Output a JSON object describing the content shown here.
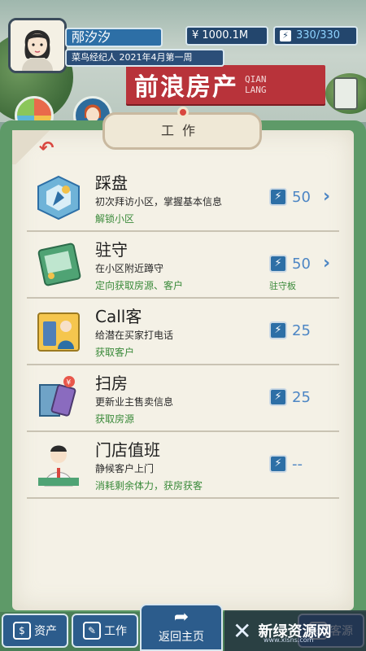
{
  "header": {
    "name": "邴汐汐",
    "rank_line": "菜鸟经纪人 2021年4月第一周",
    "money": "¥ 1000.1M",
    "energy": "330/330"
  },
  "store_sign": {
    "name": "前浪房产",
    "roman_1": "QIAN",
    "roman_2": "LANG"
  },
  "panel": {
    "tab_title": "工作"
  },
  "tasks": [
    {
      "title": "踩盘",
      "desc": "初次拜访小区，掌握基本信息",
      "unlock": "解锁小区",
      "cost": "50",
      "has_arrow": true,
      "sub_link": ""
    },
    {
      "title": "驻守",
      "desc": "在小区附近蹲守",
      "unlock": "定向获取房源、客户",
      "cost": "50",
      "has_arrow": true,
      "sub_link": "驻守板"
    },
    {
      "title": "Call客",
      "desc": "给潜在买家打电话",
      "unlock": "获取客户",
      "cost": "25",
      "has_arrow": false,
      "sub_link": ""
    },
    {
      "title": "扫房",
      "desc": "更新业主售卖信息",
      "unlock": "获取房源",
      "cost": "25",
      "has_arrow": false,
      "sub_link": ""
    },
    {
      "title": "门店值班",
      "desc": "静候客户上门",
      "unlock": "消耗剩余体力，获房获客",
      "cost": "--",
      "has_arrow": false,
      "sub_link": ""
    }
  ],
  "bottom_nav": {
    "assets": "资产",
    "work": "工作",
    "home": "返回主页",
    "last": "客源"
  },
  "watermark": {
    "text": "新绿资源网",
    "sub": "www.xlsns.com"
  }
}
